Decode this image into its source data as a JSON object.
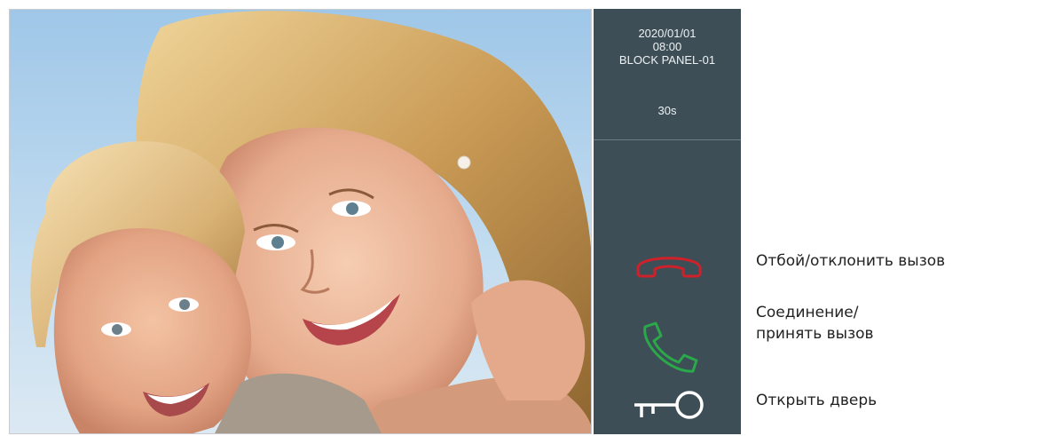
{
  "status": {
    "date": "2020/01/01",
    "time": "08:00",
    "panel_name": "BLOCK PANEL-01",
    "timer": "30s"
  },
  "controls": {
    "hangup_icon": "hangup-phone-icon",
    "answer_icon": "answer-phone-icon",
    "unlock_icon": "key-icon"
  },
  "legend": {
    "hangup": "Отбой/отклонить вызов",
    "answer": "Соединение/принять вызов",
    "unlock": "Открыть дверь"
  },
  "colors": {
    "panel_bg": "#3d4e56",
    "hangup": "#d0202a",
    "answer": "#2aa84a",
    "unlock": "#ffffff"
  }
}
